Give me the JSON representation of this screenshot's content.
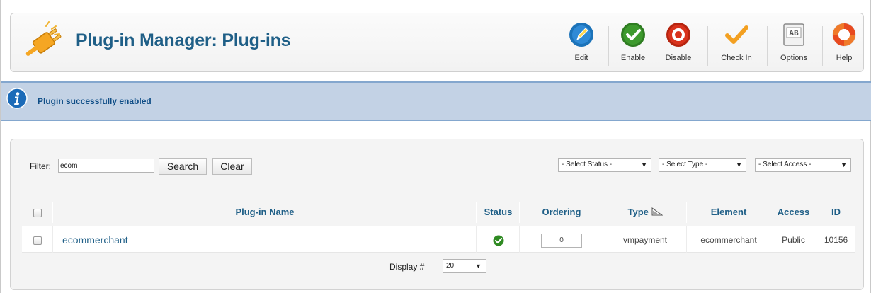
{
  "header": {
    "title": "Plug-in Manager: Plug-ins"
  },
  "toolbar": {
    "edit_label": "Edit",
    "enable_label": "Enable",
    "disable_label": "Disable",
    "checkin_label": "Check In",
    "options_label": "Options",
    "help_label": "Help",
    "options_icon_text": "AB"
  },
  "message": {
    "text": "Plugin successfully enabled"
  },
  "filter": {
    "label": "Filter:",
    "value": "ecom",
    "search_label": "Search",
    "clear_label": "Clear",
    "status_select": "- Select Status -",
    "type_select": "- Select Type -",
    "access_select": "- Select Access -"
  },
  "table": {
    "columns": {
      "name": "Plug-in Name",
      "status": "Status",
      "ordering": "Ordering",
      "type": "Type",
      "element": "Element",
      "access": "Access",
      "id": "ID"
    },
    "rows": [
      {
        "name": "ecommerchant",
        "status": "enabled",
        "ordering": "0",
        "type": "vmpayment",
        "element": "ecommerchant",
        "access": "Public",
        "id": "10156"
      }
    ]
  },
  "pagination": {
    "display_label": "Display #",
    "display_value": "20"
  },
  "colors": {
    "title": "#1f5f87",
    "message_bg": "#c3d2e5",
    "enabled_green": "#3d9a2d",
    "disable_red": "#d9321c",
    "edit_blue": "#1c73b9"
  }
}
